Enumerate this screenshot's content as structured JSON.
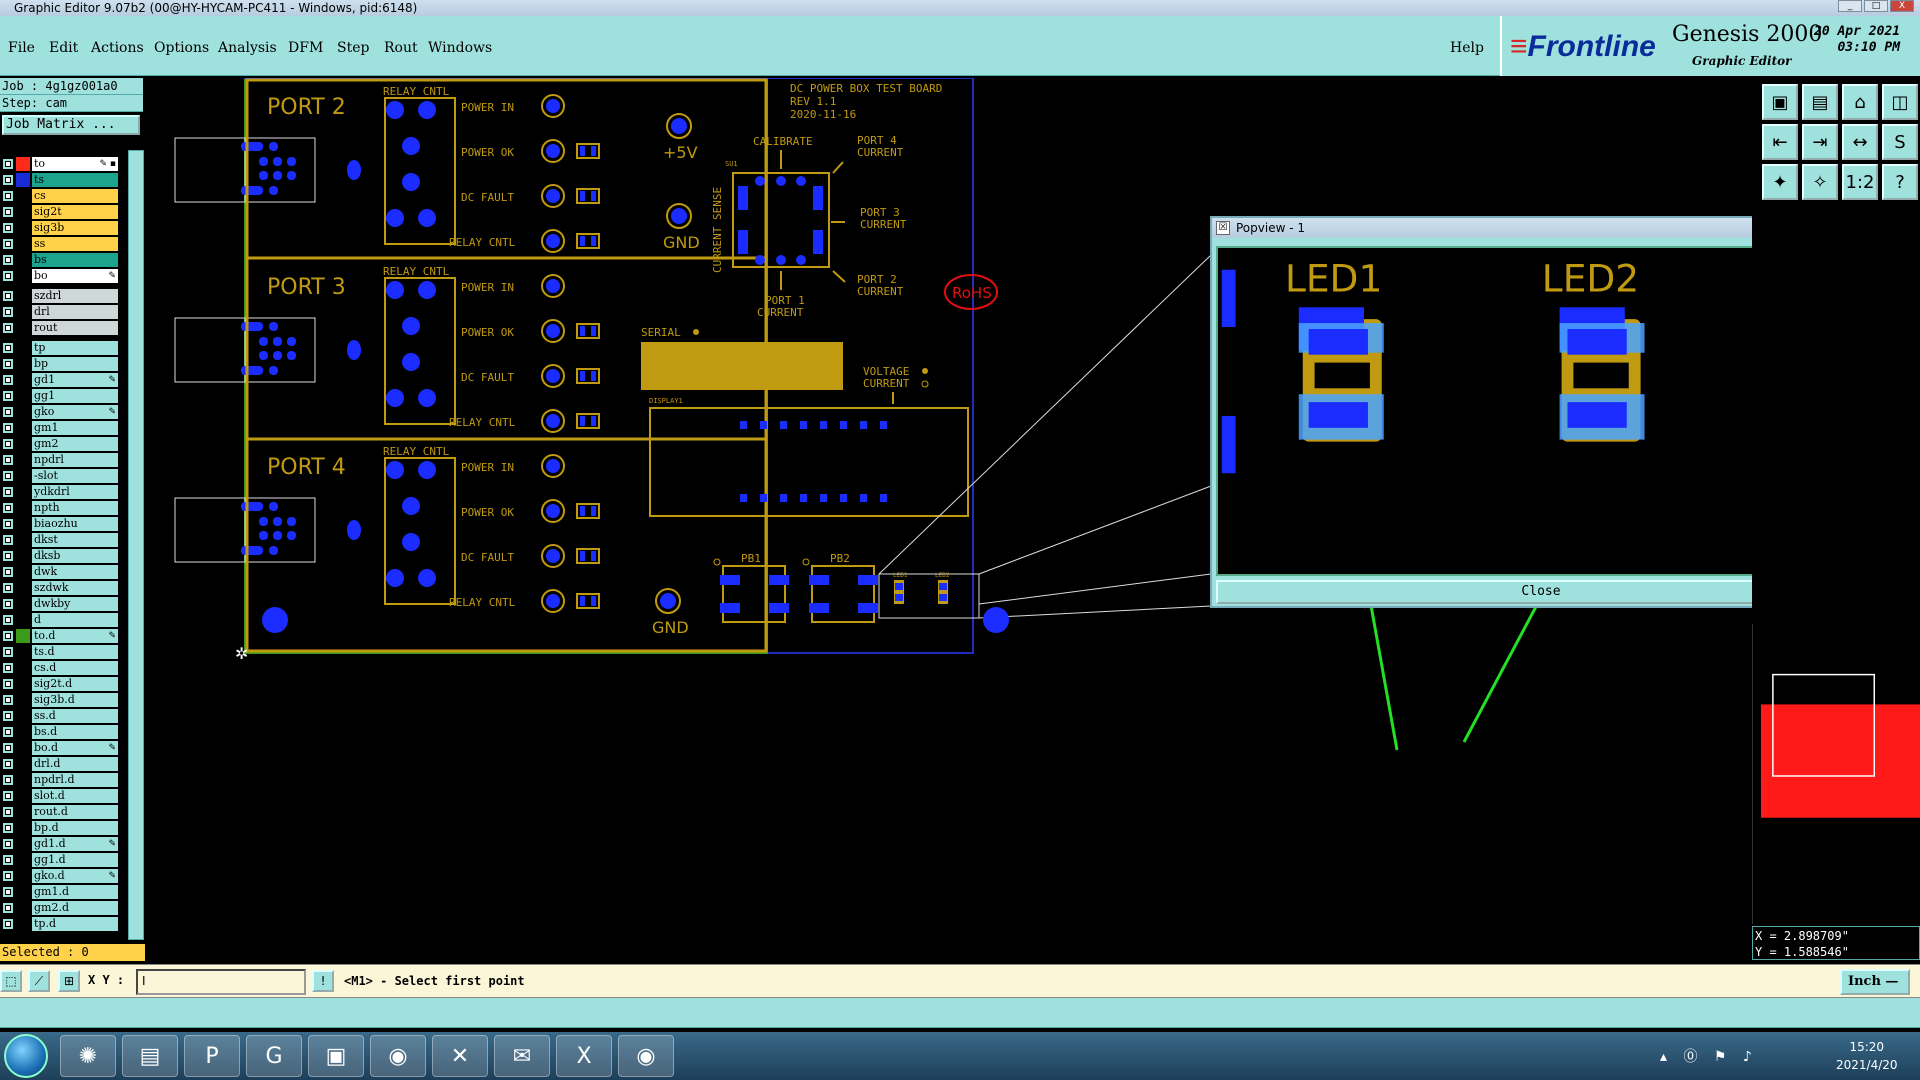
{
  "window": {
    "title": "Graphic Editor 9.07b2 (00@HY-HYCAM-PC411 - Windows, pid:6148)",
    "controls": [
      "_",
      "□",
      "X"
    ]
  },
  "menu": {
    "items": [
      "File",
      "Edit",
      "Actions",
      "Options",
      "Analysis",
      "DFM",
      "Step",
      "Rout",
      "Windows"
    ],
    "help": "Help"
  },
  "brand": {
    "logo_a": "≡",
    "logo_b": "Frontline",
    "product": "Genesis 2000",
    "subtitle": "Graphic Editor",
    "date": "20 Apr 2021",
    "time": "03:10 PM"
  },
  "panel": {
    "job": "Job : 4g1gz001a0",
    "step": "Step: cam",
    "job_matrix": "Job Matrix ...",
    "selected": "Selected : 0"
  },
  "layers": {
    "group1": [
      {
        "name": "to",
        "style": "wh",
        "color": "#ff2a1a",
        "mark": "✎ ▪"
      },
      {
        "name": "ts",
        "style": "tl",
        "color": "#1a2ad6",
        "mark": ""
      },
      {
        "name": "cs",
        "style": "or",
        "color": "",
        "mark": ""
      },
      {
        "name": "sig2t",
        "style": "or",
        "color": "",
        "mark": ""
      },
      {
        "name": "sig3b",
        "style": "or",
        "color": "",
        "mark": ""
      },
      {
        "name": "ss",
        "style": "or",
        "color": "",
        "mark": ""
      },
      {
        "name": "bs",
        "style": "tl",
        "color": "",
        "mark": ""
      },
      {
        "name": "bo",
        "style": "wh",
        "color": "",
        "mark": "✎"
      }
    ],
    "group2": [
      {
        "name": "szdrl",
        "style": "gr",
        "color": "",
        "mark": ""
      },
      {
        "name": "drl",
        "style": "gr",
        "color": "",
        "mark": ""
      },
      {
        "name": "rout",
        "style": "gr",
        "color": "",
        "mark": ""
      }
    ],
    "group3": [
      {
        "name": "tp",
        "mark": ""
      },
      {
        "name": "bp",
        "mark": ""
      },
      {
        "name": "gd1",
        "mark": "✎"
      },
      {
        "name": "gg1",
        "mark": ""
      },
      {
        "name": "gko",
        "mark": "✎"
      },
      {
        "name": "gm1",
        "mark": ""
      },
      {
        "name": "gm2",
        "mark": ""
      },
      {
        "name": "npdrl",
        "mark": ""
      },
      {
        "name": "-slot",
        "mark": ""
      },
      {
        "name": "ydkdrl",
        "mark": ""
      },
      {
        "name": "npth",
        "mark": ""
      },
      {
        "name": "biaozhu",
        "mark": ""
      },
      {
        "name": "dkst",
        "mark": ""
      },
      {
        "name": "dksb",
        "mark": ""
      },
      {
        "name": "dwk",
        "mark": ""
      },
      {
        "name": "szdwk",
        "mark": ""
      },
      {
        "name": "dwkby",
        "mark": ""
      },
      {
        "name": "d",
        "mark": ""
      },
      {
        "name": "to.d",
        "mark": "✎",
        "color": "#3a9a1a"
      },
      {
        "name": "ts.d",
        "mark": ""
      },
      {
        "name": "cs.d",
        "mark": ""
      },
      {
        "name": "sig2t.d",
        "mark": ""
      },
      {
        "name": "sig3b.d",
        "mark": ""
      },
      {
        "name": "ss.d",
        "mark": ""
      },
      {
        "name": "bs.d",
        "mark": ""
      },
      {
        "name": "bo.d",
        "mark": "✎"
      },
      {
        "name": "drl.d",
        "mark": ""
      },
      {
        "name": "npdrl.d",
        "mark": ""
      },
      {
        "name": "slot.d",
        "mark": ""
      },
      {
        "name": "rout.d",
        "mark": ""
      },
      {
        "name": "bp.d",
        "mark": ""
      },
      {
        "name": "gd1.d",
        "mark": "✎"
      },
      {
        "name": "gg1.d",
        "mark": ""
      },
      {
        "name": "gko.d",
        "mark": "✎"
      },
      {
        "name": "gm1.d",
        "mark": ""
      },
      {
        "name": "gm2.d",
        "mark": ""
      },
      {
        "name": "tp.d",
        "mark": ""
      }
    ]
  },
  "board": {
    "ports": [
      "PORT 2",
      "PORT 3",
      "PORT 4"
    ],
    "relay": "RELAY CNTL",
    "signals": [
      "POWER IN",
      "POWER OK",
      "DC FAULT",
      "RELAY CNTL"
    ],
    "title": [
      "DC POWER BOX TEST BOARD",
      "REV 1.1",
      "2020-11-16"
    ],
    "plus5v": "+5V",
    "gnd": "GND",
    "gnd2": "GND",
    "calibrate": "CALIBRATE",
    "current_sense": "CURRENT SENSE",
    "u1": "SU1",
    "p4c": [
      "PORT 4",
      "CURRENT"
    ],
    "p3c": [
      "PORT 3",
      "CURRENT"
    ],
    "p2c": [
      "PORT 2",
      "CURRENT"
    ],
    "p1c": [
      "PORT 1",
      "CURRENT"
    ],
    "rohs": "RoHS",
    "serial": "SERIAL",
    "voltage": "VOLTAGE",
    "current": "CURRENT",
    "display": "DISPLAY1",
    "pb1": "PB1",
    "pb2": "PB2",
    "led_small1": "LED1",
    "led_small2": "LED2"
  },
  "popview": {
    "title": "Popview - 1",
    "icon": "☒",
    "close_x": "X",
    "led1": "LED1",
    "led2": "LED2",
    "close": "Close"
  },
  "coords": {
    "x": "X = 2.898709\"",
    "y": "Y = 1.588546\""
  },
  "status": {
    "xy_label": "X Y :",
    "input": "I",
    "message": "<M1> - Select first point",
    "unit": "Inch —"
  },
  "taskbar": {
    "time": "15:20",
    "date": "2021/4/20",
    "tray": "▴ ⓪ ⚑ ♪"
  },
  "tools": {
    "main": [
      "▣",
      "▤",
      "⌂",
      "◫",
      "⇤",
      "⇥",
      "↔",
      "S",
      "✦",
      "✧",
      "1:2",
      "?"
    ],
    "pop": [
      "❐",
      "▲",
      "▼",
      "◧",
      "⇥",
      "✣",
      "⌖"
    ]
  },
  "colors": {
    "board_outline": "#2d3bff",
    "silk": "#c09a10",
    "pad": "#1a2cff",
    "selection_arrow": "#22e022",
    "rohs": "#e01010"
  }
}
